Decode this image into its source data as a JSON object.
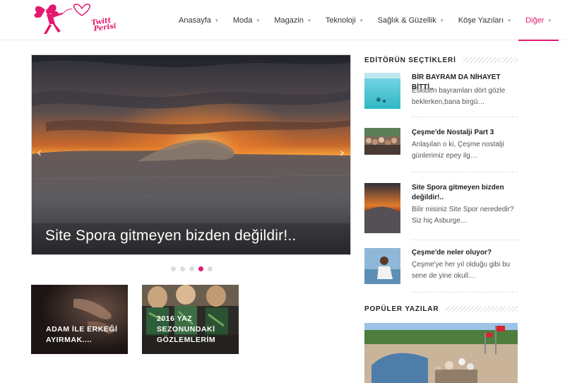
{
  "logo": {
    "line1": "Twitt",
    "line2": "Perisi"
  },
  "nav": [
    {
      "label": "Anasayfa",
      "has_dropdown": true,
      "active": false
    },
    {
      "label": "Moda",
      "has_dropdown": true,
      "active": false
    },
    {
      "label": "Magazin",
      "has_dropdown": true,
      "active": false
    },
    {
      "label": "Teknoloji",
      "has_dropdown": true,
      "active": false
    },
    {
      "label": "Sağlık & Güzellik",
      "has_dropdown": true,
      "active": false
    },
    {
      "label": "Köşe Yazıları",
      "has_dropdown": true,
      "active": false
    },
    {
      "label": "Diğer",
      "has_dropdown": true,
      "active": true
    }
  ],
  "slider": {
    "caption": "Site Spora gitmeyen bizden değildir!..",
    "prev_icon": "chevron-left-icon",
    "next_icon": "chevron-right-icon",
    "dot_count": 5,
    "active_dot": 4
  },
  "cards": [
    {
      "title": "ADAM İLE ERKEĞİ AYIRMAK...."
    },
    {
      "title": "2016 YAZ SEZONUNDAKİ GÖZLEMLERİM"
    }
  ],
  "sidebar": {
    "editors_heading": "EDİTÖRÜN SEÇTİKLERİ",
    "posts": [
      {
        "title": "BİR BAYRAM DA NİHAYET BİTTİ..",
        "excerpt": "Eskiden bayramları dört gözle beklerken,bana birgü…"
      },
      {
        "title": "Çeşme'de Nostalji Part 3",
        "excerpt": "Anlaşılan o ki, Çeşme nostalji günlerimiz epey ilg…"
      },
      {
        "title": "Site Spora gitmeyen bizden değildir!..",
        "excerpt": "Bilir misiniz Site Spor nerededir? Siz hiç Asburge…"
      },
      {
        "title": "Çeşme'de neler oluyor?",
        "excerpt": "Çeşme'ye her yıl olduğu gibi bu sene de yine okull…"
      }
    ],
    "popular_heading": "POPÜLER YAZILAR"
  },
  "colors": {
    "accent": "#e4186e",
    "text": "#333333",
    "border": "#ececec"
  }
}
